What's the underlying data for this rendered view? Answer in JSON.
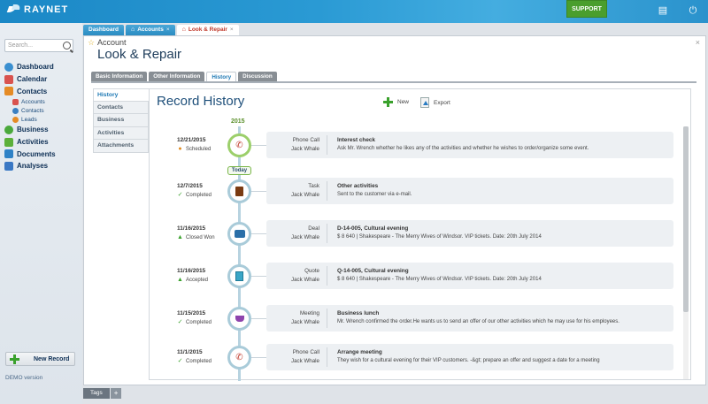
{
  "app": {
    "name": "RAYNET",
    "support_label": "SUPPORT"
  },
  "sidebar": {
    "search_placeholder": "Search...",
    "items": [
      {
        "label": "Dashboard",
        "icon": "cloud-icon",
        "color": "#3a8fd0"
      },
      {
        "label": "Calendar",
        "icon": "calendar-icon",
        "color": "#d9534f"
      },
      {
        "label": "Contacts",
        "icon": "contacts-icon",
        "color": "#e58b25"
      },
      {
        "label": "Business",
        "icon": "dollar-icon",
        "color": "#4aa93b"
      },
      {
        "label": "Activities",
        "icon": "activities-icon",
        "color": "#5cb03a"
      },
      {
        "label": "Documents",
        "icon": "documents-icon",
        "color": "#2f82c6"
      },
      {
        "label": "Analyses",
        "icon": "chart-icon",
        "color": "#3a78c4"
      }
    ],
    "sub_items": [
      {
        "label": "Accounts",
        "color": "#d9534f"
      },
      {
        "label": "Contacts",
        "color": "#3a7fc2"
      },
      {
        "label": "Leads",
        "color": "#e58b25"
      }
    ],
    "new_record_label": "New Record",
    "demo_label": "DEMO version"
  },
  "tabs": [
    {
      "label": "Dashboard",
      "closable": false,
      "active": false
    },
    {
      "label": "Accounts",
      "closable": true,
      "active": false
    },
    {
      "label": "Look & Repair",
      "closable": true,
      "active": true
    }
  ],
  "record": {
    "type_label": "Account",
    "title": "Look & Repair"
  },
  "sub_tabs": [
    "Basic Information",
    "Other Information",
    "History",
    "Discussion"
  ],
  "left_tabs": [
    "History",
    "Contacts",
    "Business",
    "Activities",
    "Attachments"
  ],
  "history": {
    "title": "Record History",
    "new_label": "New",
    "export_label": "Export",
    "year": "2015",
    "today_label": "Today",
    "records": [
      {
        "date": "12/21/2015",
        "status": "Scheduled",
        "status_icon": "clock-icon",
        "type": "Phone Call",
        "owner": "Jack Whale",
        "title": "Interest check",
        "desc": "Ask Mr. Wrench whether he likes any of the activities and whether he wishes to order/organize some event.",
        "icon": "phone-icon"
      },
      {
        "date": "12/7/2015",
        "status": "Completed",
        "status_icon": "check-icon",
        "type": "Task",
        "owner": "Jack Whale",
        "title": "Other activities",
        "desc": "Sent to the customer via e-mail.",
        "icon": "task-icon"
      },
      {
        "date": "11/16/2015",
        "status": "Closed Won",
        "status_icon": "thumbs-up-icon",
        "type": "Deal",
        "owner": "Jack Whale",
        "title": "D-14-005, Cultural evening",
        "desc": "$ 8 640 | Shakespeare - The Merry Wives of Windsor. VIP tickets. Date: 20th July 2014",
        "icon": "briefcase-icon"
      },
      {
        "date": "11/16/2015",
        "status": "Accepted",
        "status_icon": "thumbs-up-icon",
        "type": "Quote",
        "owner": "Jack Whale",
        "title": "Q-14-005, Cultural evening",
        "desc": "$ 8 640 | Shakespeare - The Merry Wives of Windsor. VIP tickets. Date: 20th July 2014",
        "icon": "quote-icon"
      },
      {
        "date": "11/15/2015",
        "status": "Completed",
        "status_icon": "check-icon",
        "type": "Meeting",
        "owner": "Jack Whale",
        "title": "Business lunch",
        "desc": "Mr. Wrench confirmed the order.He wants us to send an offer of our other activities which he may use for his employees.",
        "icon": "cup-icon"
      },
      {
        "date": "11/1/2015",
        "status": "Completed",
        "status_icon": "check-icon",
        "type": "Phone Call",
        "owner": "Jack Whale",
        "title": "Arrange meeting",
        "desc": "They wish for a cultural evening for their VIP customers. -&gt; prepare an offer and suggest a date for a meeting",
        "icon": "phone-icon"
      }
    ]
  },
  "footer": {
    "tags_label": "Tags",
    "tags_add": "+"
  }
}
